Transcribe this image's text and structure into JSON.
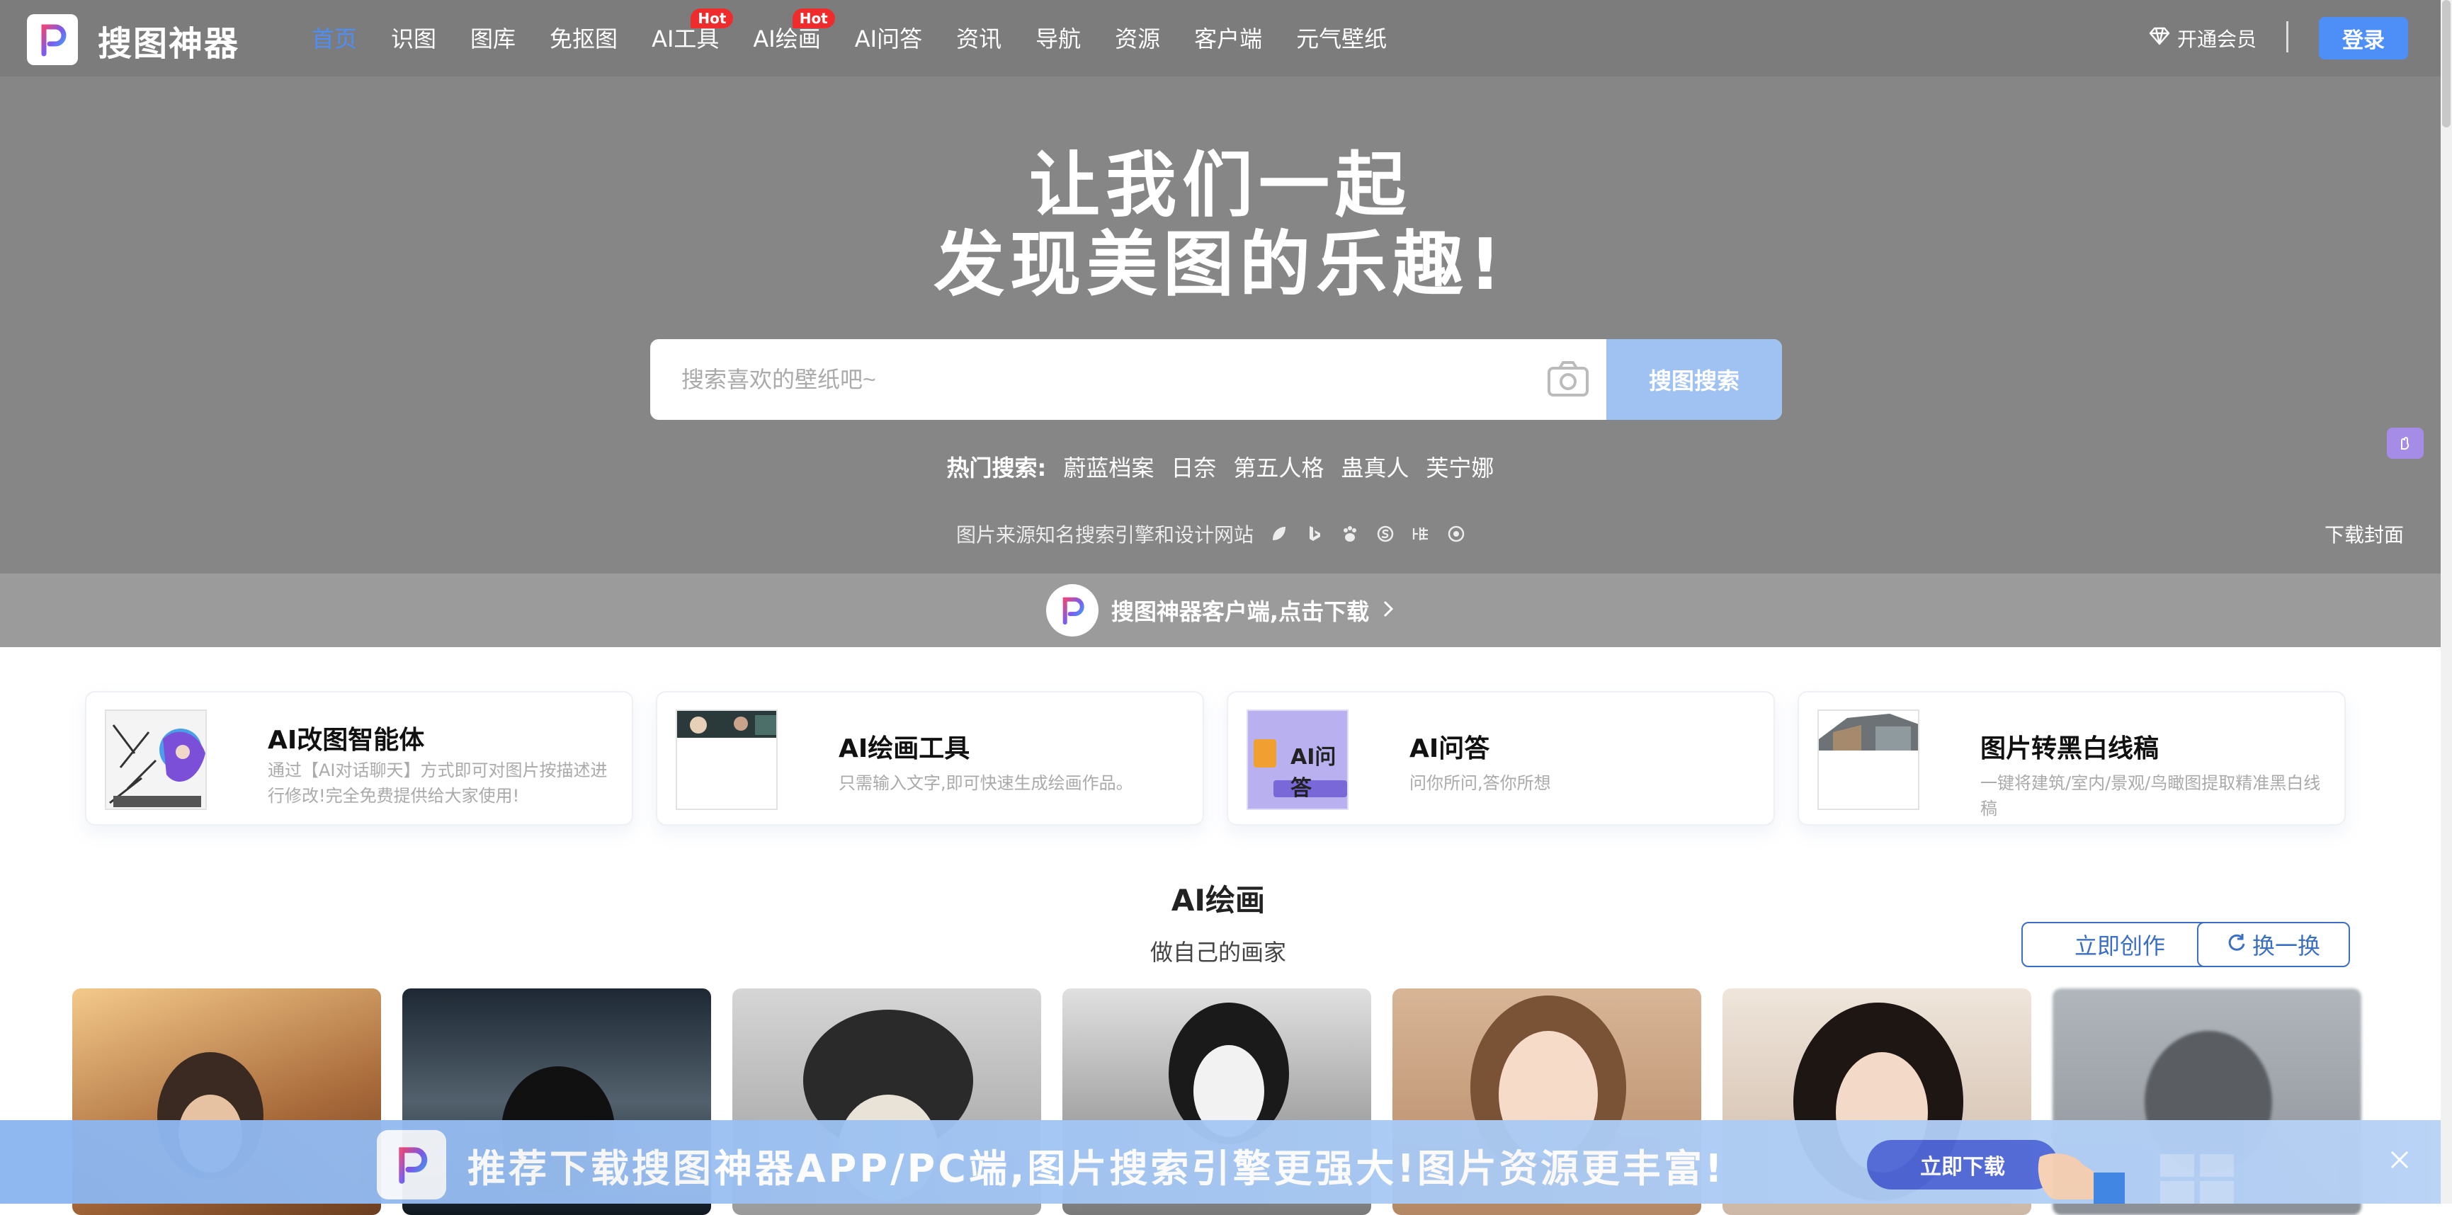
{
  "brand": {
    "name": "搜图神器"
  },
  "nav": [
    {
      "label": "首页",
      "hot": ""
    },
    {
      "label": "识图",
      "hot": ""
    },
    {
      "label": "图库",
      "hot": ""
    },
    {
      "label": "免抠图",
      "hot": ""
    },
    {
      "label": "AI工具",
      "hot": "Hot"
    },
    {
      "label": "AI绘画",
      "hot": "Hot"
    },
    {
      "label": "AI问答",
      "hot": ""
    },
    {
      "label": "资讯",
      "hot": ""
    },
    {
      "label": "导航",
      "hot": ""
    },
    {
      "label": "资源",
      "hot": ""
    },
    {
      "label": "客户端",
      "hot": ""
    },
    {
      "label": "元气壁纸",
      "hot": ""
    }
  ],
  "header": {
    "vip_label": "开通会员",
    "login_label": "登录"
  },
  "hero": {
    "slogan_line1": "让我们一起",
    "slogan_line2": "发现美图的乐趣!",
    "search_placeholder": "搜索喜欢的壁纸吧~",
    "search_button": "搜图搜索",
    "hot_label": "热门搜索:",
    "hot_terms": [
      "蔚蓝档案",
      "日奈",
      "第五人格",
      "蛊真人",
      "芙宁娜"
    ],
    "sources_text": "图片来源知名搜索引擎和设计网站",
    "download_cover": "下载封面"
  },
  "client_bar": {
    "text": "搜图神器客户端,点击下载"
  },
  "cards": [
    {
      "title": "AI改图智能体",
      "desc": "通过【AI对话聊天】方式即可对图片按描述进行修改!完全免费提供给大家使用!"
    },
    {
      "title": "AI绘画工具",
      "desc": "只需输入文字,即可快速生成绘画作品。"
    },
    {
      "title": "AI问答",
      "desc": "问你所问,答你所想",
      "thumb_text": "AI问答"
    },
    {
      "title": "图片转黑白线稿",
      "desc": "一键将建筑/室内/景观/鸟瞰图提取精准黑白线稿"
    }
  ],
  "section": {
    "title": "AI绘画",
    "subtitle": "做自己的画家",
    "create_btn": "立即创作",
    "refresh_btn": "换一换"
  },
  "banner": {
    "text": "推荐下载搜图神器APP/PC端,图片搜索引擎更强大!图片资源更丰富!",
    "button": "立即下载"
  },
  "colors": {
    "accent": "#4d8ef7",
    "hot": "#ef2b2b",
    "hero_bg": "#868686"
  }
}
